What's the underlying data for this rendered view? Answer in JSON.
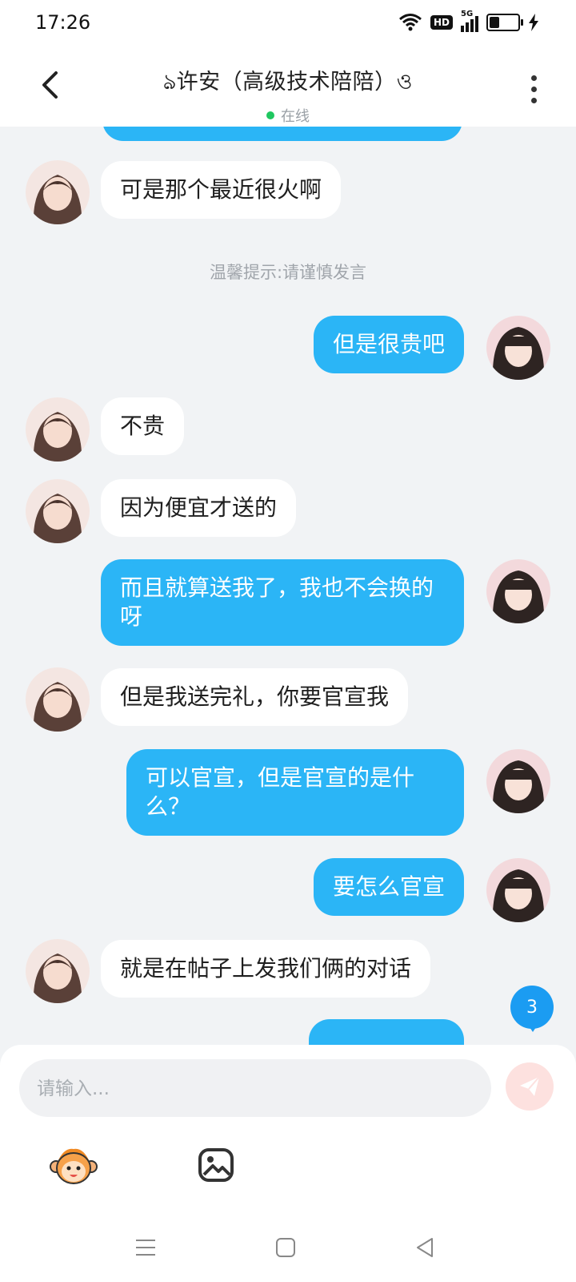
{
  "status_bar": {
    "time": "17:26",
    "hd_label": "HD",
    "network": "5G",
    "battery_percent": 35
  },
  "header": {
    "title": "ঌ许安（高级技术陪陪）ও",
    "online_label": "在线"
  },
  "notice": "温馨提示:请谨慎发言",
  "messages": [
    {
      "side": "in",
      "text": "可是那个最近很火啊"
    },
    {
      "side": "out",
      "text": "但是很贵吧"
    },
    {
      "side": "in",
      "text": "不贵"
    },
    {
      "side": "in",
      "text": "因为便宜才送的"
    },
    {
      "side": "out",
      "text": "而且就算送我了，我也不会换的呀"
    },
    {
      "side": "in",
      "text": "但是我送完礼，你要官宣我"
    },
    {
      "side": "out",
      "text": "可以官宣，但是官宣的是什么？"
    },
    {
      "side": "out",
      "text": "要怎么官宣"
    },
    {
      "side": "in",
      "text": "就是在帖子上发我们俩的对话"
    }
  ],
  "unread_count": "3",
  "composer": {
    "placeholder": "请输入..."
  },
  "icons": {
    "back": "chevron-left-icon",
    "more": "more-vertical-icon",
    "send": "send-icon",
    "emoji": "monkey-emoji-icon",
    "image": "image-icon",
    "nav_menu": "menu-icon",
    "nav_home": "home-square-icon",
    "nav_back": "back-triangle-icon"
  },
  "colors": {
    "outgoing_bubble": "#2bb5f6",
    "incoming_bubble": "#ffffff",
    "background": "#f1f3f5",
    "online_dot": "#1fc760",
    "unread_badge": "#1b9cf2"
  }
}
